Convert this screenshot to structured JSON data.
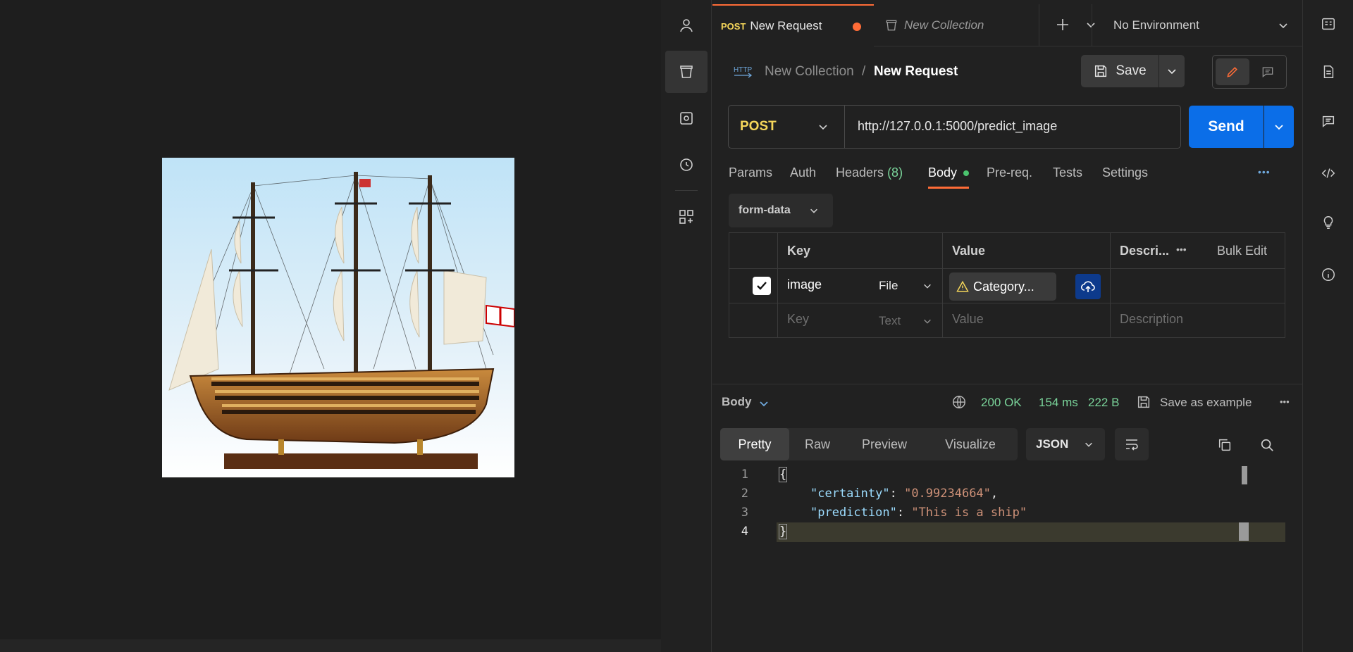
{
  "tabs": {
    "active": {
      "method": "POST",
      "title": "New Request"
    },
    "inactive": {
      "title": "New Collection"
    },
    "environment": "No Environment"
  },
  "breadcrumb": {
    "collection": "New Collection",
    "separator": "/",
    "request": "New Request"
  },
  "toolbar": {
    "save_label": "Save"
  },
  "request": {
    "method": "POST",
    "url": "http://127.0.0.1:5000/predict_image",
    "send_label": "Send"
  },
  "request_tabs": {
    "params": "Params",
    "auth": "Auth",
    "headers": "Headers",
    "headers_count": "(8)",
    "body": "Body",
    "prereq": "Pre-req.",
    "tests": "Tests",
    "settings": "Settings",
    "more": "•••"
  },
  "body_type": "form-data",
  "form_table": {
    "headers": {
      "key": "Key",
      "value": "Value",
      "description": "Descri...",
      "bulk_edit": "Bulk Edit",
      "more": "•••"
    },
    "rows": [
      {
        "key": "image",
        "type": "File",
        "value": "Category..."
      },
      {
        "key": "Key",
        "type": "Text",
        "value": "Value",
        "description": "Description"
      }
    ]
  },
  "response": {
    "label": "Body",
    "status": "200 OK",
    "time": "154 ms",
    "size": "222 B",
    "save_example": "Save as example",
    "more": "•••",
    "views": [
      "Pretty",
      "Raw",
      "Preview",
      "Visualize"
    ],
    "format": "JSON",
    "lines": [
      {
        "n": "1",
        "text": "{"
      },
      {
        "n": "2",
        "key": "\"certainty\"",
        "value": "\"0.99234664\"",
        "tail": ","
      },
      {
        "n": "3",
        "key": "\"prediction\"",
        "value": "\"This is a ship\"",
        "tail": ""
      },
      {
        "n": "4",
        "text": "}"
      }
    ]
  },
  "colors": {
    "accent_orange": "#ff6c37",
    "send_blue": "#0b6ee8",
    "status_green": "#7ad49a",
    "json_key": "#9cdcfe",
    "json_string": "#ce9178",
    "method_yellow": "#f5d65a"
  }
}
